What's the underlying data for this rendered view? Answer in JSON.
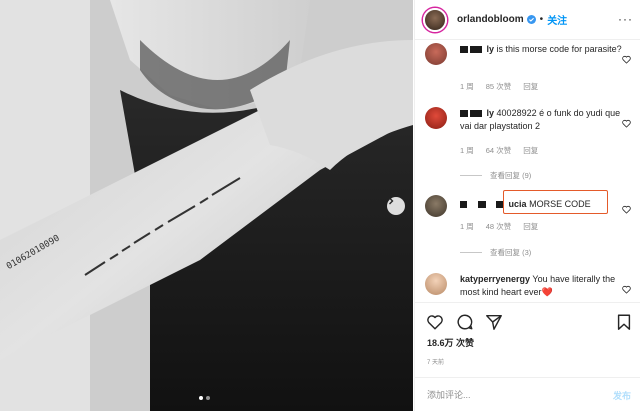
{
  "post": {
    "username": "orlandobloom",
    "separator": "•",
    "follow_label": "关注",
    "more_label": "···",
    "likes": "18.6万 次赞",
    "time": "7 天前",
    "add_comment_placeholder": "添加评论...",
    "post_label": "发布",
    "tattoo_text": "01062010090",
    "photo_dots": {
      "count": 2,
      "active": 1
    }
  },
  "comments": [
    {
      "user_visible": "ly",
      "text": "is this morse code for parasite?",
      "time": "1 周",
      "likes": "85 次赞",
      "reply_label": "回复"
    },
    {
      "user_visible": "ly",
      "text": "40028922 é o funk do yudi que vai dar playstation 2",
      "time": "1 周",
      "likes": "64 次赞",
      "reply_label": "回复",
      "view_replies": "查看回复 (9)"
    },
    {
      "user_visible": "ucia",
      "text": "MORSE CODE",
      "time": "1 周",
      "likes": "48 次赞",
      "reply_label": "回复",
      "view_replies": "查看回复 (3)"
    },
    {
      "user_visible": "katyperryenergy",
      "text": "You have literally the most kind heart ever",
      "heart_emoji": "❤️"
    }
  ],
  "colors": {
    "accent_blue": "#0095f6",
    "highlight_box": "#e45a2a",
    "meta_gray": "#8e8e8e"
  },
  "icons": [
    "next-arrow-icon",
    "verified-badge-icon",
    "heart-icon",
    "comment-icon",
    "share-icon",
    "bookmark-icon"
  ]
}
